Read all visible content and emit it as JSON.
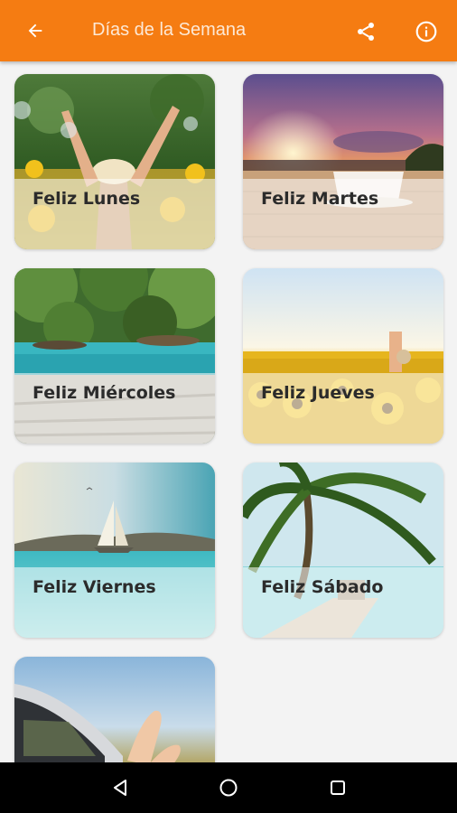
{
  "appbar": {
    "title": "Días de la Semana",
    "background": "#f57c12",
    "icons": [
      "arrow-back-icon",
      "share-icon",
      "info-icon"
    ]
  },
  "cards": [
    {
      "label": "Feliz Lunes",
      "image": "woman-arms-raised-sunflowers-photo"
    },
    {
      "label": "Feliz Martes",
      "image": "sunset-coffee-cup-photo"
    },
    {
      "label": "Feliz Miércoles",
      "image": "turquoise-lake-forest-photo"
    },
    {
      "label": "Feliz Jueves",
      "image": "sunflower-field-photo"
    },
    {
      "label": "Feliz Viernes",
      "image": "sailboat-sea-photo"
    },
    {
      "label": "Feliz Sábado",
      "image": "palm-tree-beach-pier-photo"
    },
    {
      "label": "",
      "image": "car-window-feet-photo"
    }
  ],
  "system_nav": {
    "icons": [
      "back-triangle-icon",
      "home-circle-icon",
      "recents-square-icon"
    ]
  }
}
